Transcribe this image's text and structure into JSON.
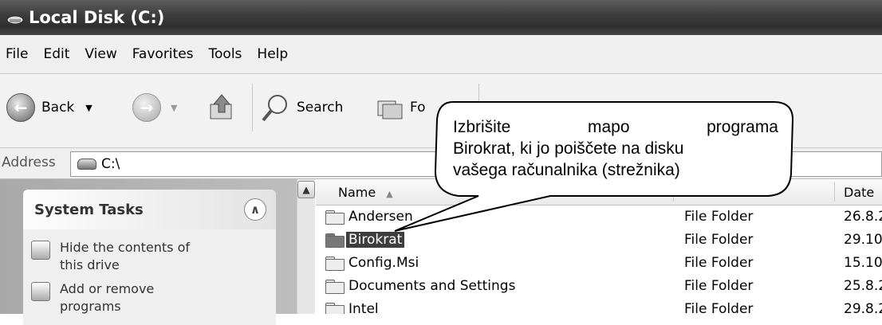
{
  "window": {
    "title": "Local Disk (C:)"
  },
  "menu": [
    "File",
    "Edit",
    "View",
    "Favorites",
    "Tools",
    "Help"
  ],
  "toolbar": {
    "back_label": "Back",
    "search_label": "Search",
    "folders_label": "Fo"
  },
  "address": {
    "label": "Address",
    "value": "C:\\"
  },
  "system_tasks": {
    "title": "System Tasks",
    "items": [
      {
        "line1": "Hide the contents of",
        "line2": "this drive",
        "icon": "hide-drive-icon"
      },
      {
        "line1": "Add or remove",
        "line2": "programs",
        "icon": "add-remove-icon"
      }
    ]
  },
  "columns": {
    "name": "Name",
    "date": "Date"
  },
  "files": [
    {
      "name": "Andersen",
      "type": "File Folder",
      "date": "26.8.2"
    },
    {
      "name": "Birokrat",
      "type": "File Folder",
      "date": "29.10"
    },
    {
      "name": "Config.Msi",
      "type": "File Folder",
      "date": "15.10"
    },
    {
      "name": "Documents and Settings",
      "type": "File Folder",
      "date": "25.8.2"
    },
    {
      "name": "Intel",
      "type": "File Folder",
      "date": "29.8.2"
    }
  ],
  "callout": {
    "words_line1": [
      "Izbrišite",
      "mapo",
      "programa"
    ],
    "line2": "Birokrat, ki jo poiščete na disku",
    "line3": "vašega računalnika (strežnika)"
  }
}
